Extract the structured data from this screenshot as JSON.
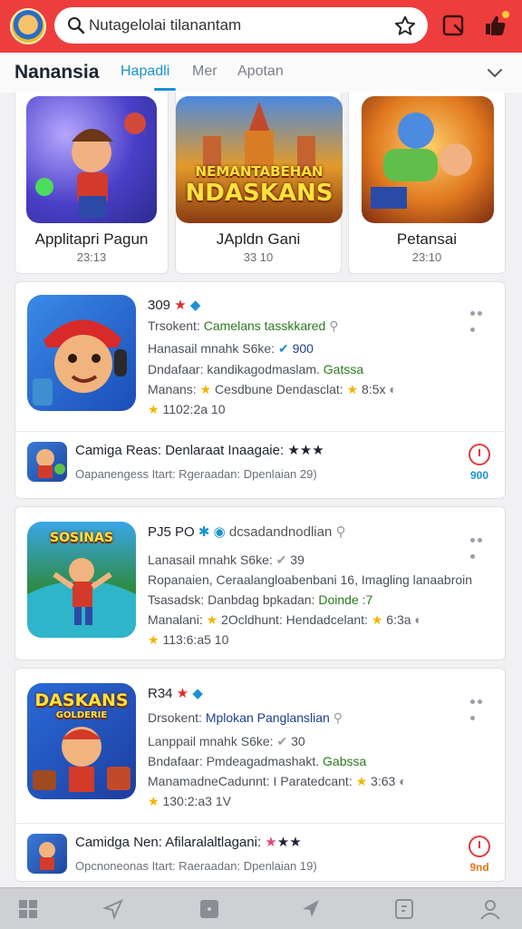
{
  "header": {
    "search_value": "Nutagelolai tilanantam",
    "colors": {
      "bar": "#ee3d3d",
      "accent": "#1a91d1"
    }
  },
  "tabs": {
    "brand": "Nanansia",
    "items": [
      {
        "label": "Hapadli",
        "active": true
      },
      {
        "label": "Mer",
        "active": false
      },
      {
        "label": "Apotan",
        "active": false
      }
    ]
  },
  "featured": [
    {
      "title": "Applitapri Pagun",
      "date": "23:13",
      "art_text": ""
    },
    {
      "title": "JApldn Gani",
      "date": "33 10",
      "art_text_1": "NEMANTABEHAN",
      "art_text_2": "NDASKANS"
    },
    {
      "title": "Petansai",
      "date": "23:10",
      "art_text": ""
    }
  ],
  "cards": [
    {
      "title": "309",
      "line2_a": "Trsokent:",
      "line2_b": "Camelans tasskkared",
      "line3_a": "Hanasail mnahk S6ke:",
      "line3_b": "900",
      "line4_a": "Dndafaar: kandikagodmaslam.",
      "line4_b": "Gatssa",
      "line5_a": "Manans:",
      "line5_b": "Cesdbune Dendasclat:",
      "line5_c": "8:5x",
      "rating": "1102:2a 10",
      "sub": {
        "title": "Camiga Reas: Denlaraat Inaagaie:",
        "meta": "Oapanengess Itart: Rgeraadan: Dpenlaian 29)",
        "badge": "900",
        "badge_color": "#1a91d1"
      }
    },
    {
      "title": "PJ5 PO",
      "line2_a": "",
      "line2_b": "dcsadandnodlian",
      "line3_a": "Lanasail mnahk S6ke:",
      "line3_b": "39",
      "line4_a": "Ropanaien, Ceraalangloabenbani 16, Imagling lanaabroin",
      "line4_b": "",
      "line5_a": "Tsasadsk: Danbdag bpkadan:",
      "line5_b": "Doinde :7",
      "line6_a": "Manalani:",
      "line6_b": "2Ocldhunt: Hendadcelant:",
      "line6_c": "6:3a",
      "rating": "113:6:a5 10",
      "art_text_1": "SOSINAS"
    },
    {
      "title": "R34",
      "line2_a": "Drsokent:",
      "line2_b": "Mplokan Panglanslian",
      "line3_a": "Lanppail mnahk S6ke:",
      "line3_b": "30",
      "line4_a": "Bndafaar: Pmdeagadmashakt.",
      "line4_b": "Gabssa",
      "line5_a": "ManamadneCadunnt: I Paratedcant:",
      "line5_b": "3:63",
      "rating": "130:2:a3 1V",
      "art_text_1": "DASKANS",
      "art_text_2": "GOLDERIE",
      "sub": {
        "title": "Camidga Nen: Afilaralaltlagani:",
        "meta": "Opcnoneonas Itart: Raeraadan: Dpenlaian 19)",
        "badge": "9nd",
        "badge_color": "#e2771a"
      }
    }
  ],
  "bottom_nav": [
    "home-icon",
    "send-icon",
    "square-icon",
    "navigate-icon",
    "tag-icon",
    "profile-icon"
  ]
}
